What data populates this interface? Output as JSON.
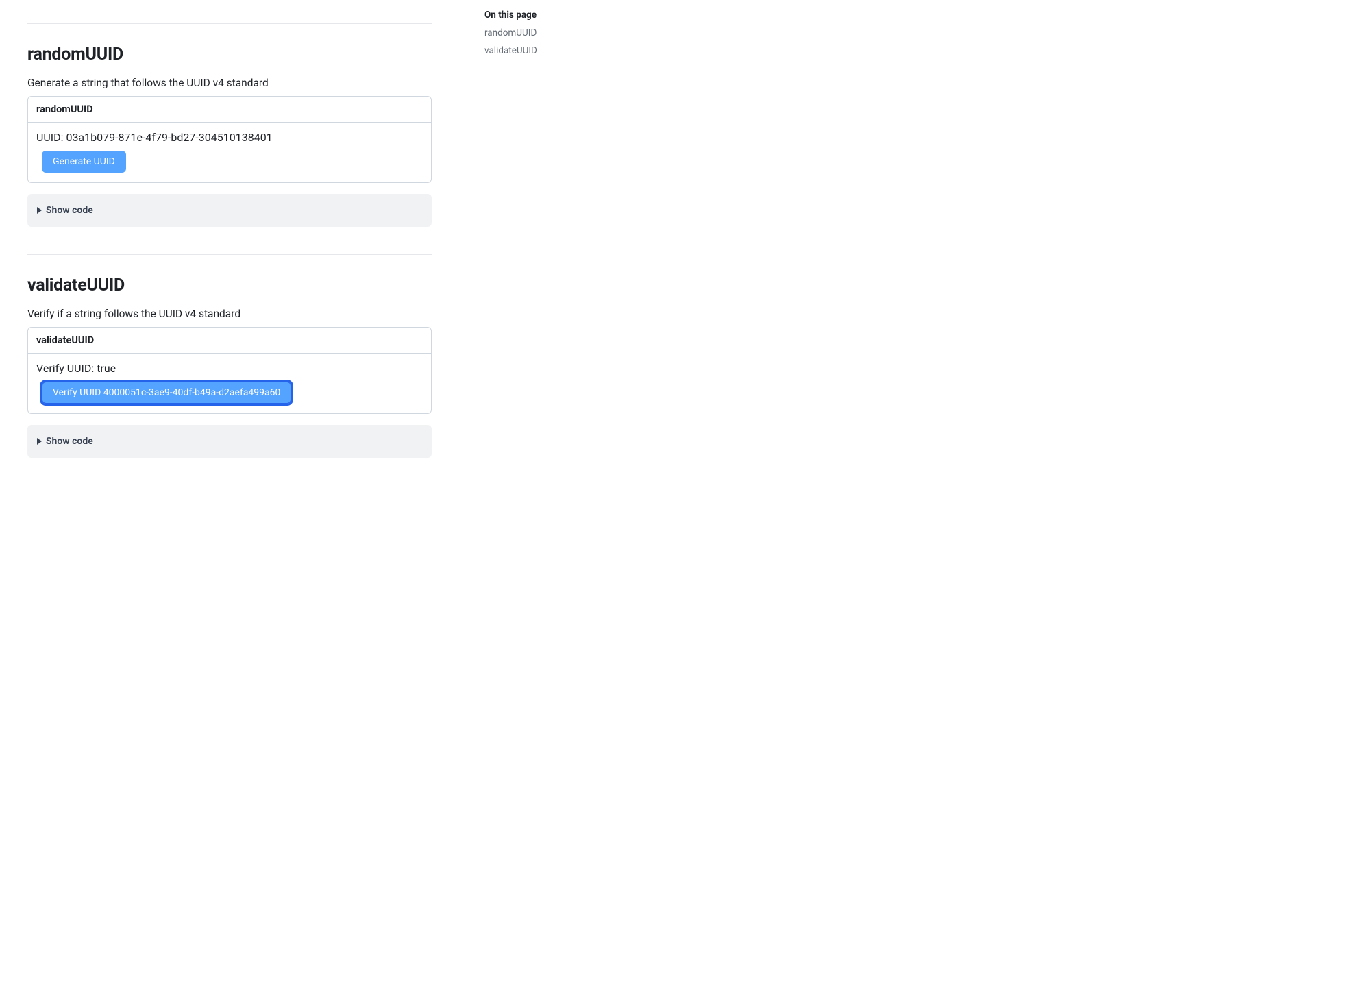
{
  "toc": {
    "title": "On this page",
    "items": [
      "randomUUID",
      "validateUUID"
    ]
  },
  "sections": [
    {
      "heading": "randomUUID",
      "desc": "Generate a string that follows the UUID v4 standard",
      "card_title": "randomUUID",
      "output": "UUID: 03a1b079-871e-4f79-bd27-304510138401",
      "button": "Generate UUID",
      "button_focused": false,
      "showcode": "Show code"
    },
    {
      "heading": "validateUUID",
      "desc": "Verify if a string follows the UUID v4 standard",
      "card_title": "validateUUID",
      "output": "Verify UUID: true",
      "button": "Verify UUID 4000051c-3ae9-40df-b49a-d2aefa499a60",
      "button_focused": true,
      "showcode": "Show code"
    }
  ]
}
